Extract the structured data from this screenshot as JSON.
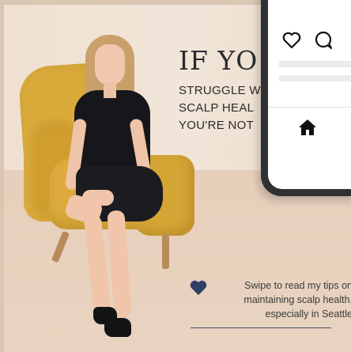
{
  "headline": {
    "big": "IF YO",
    "line1": "STRUGGLE W",
    "line2": "SCALP HEAL",
    "line3": "YOU'RE NOT"
  },
  "caption": {
    "text": "Swipe to read my tips on maintaining scalp health, especially in Seattle"
  },
  "colors": {
    "accent_navy": "#2f3f66",
    "chair_mustard": "#d9a93a",
    "phone_frame": "#2f3134"
  },
  "phone": {
    "icons": [
      "heart-outline-icon",
      "comment-bubble-icon",
      "home-icon"
    ]
  }
}
